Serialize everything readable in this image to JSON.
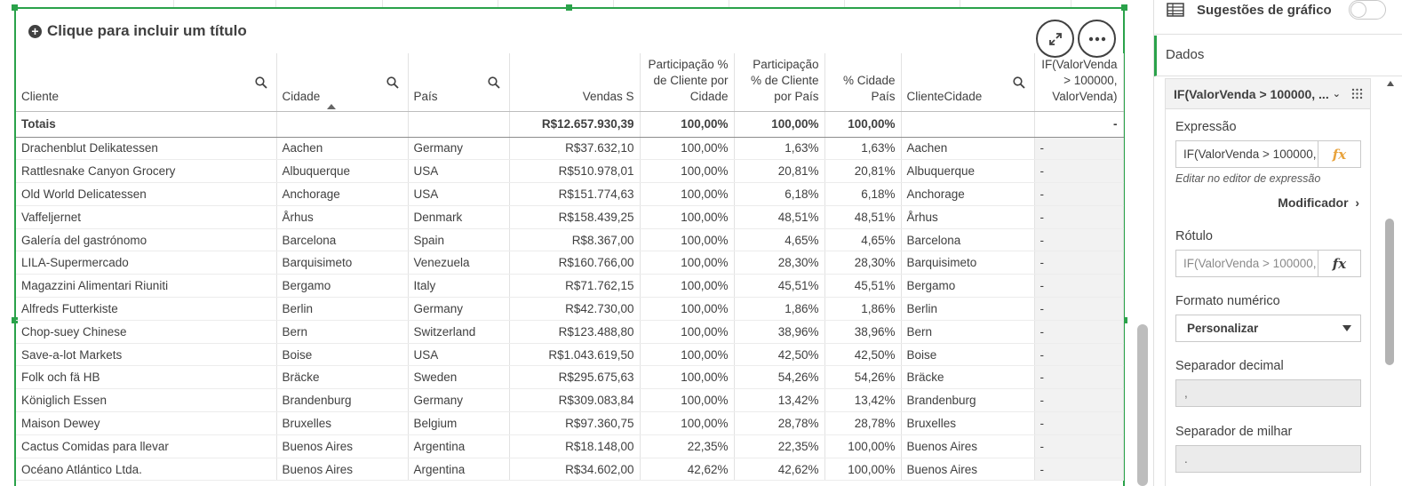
{
  "sheet": {
    "title_placeholder": "Clique para incluir um título"
  },
  "table": {
    "headers": [
      {
        "label": "Cliente",
        "searchable": true
      },
      {
        "label": "Cidade",
        "searchable": true,
        "sorted": "asc"
      },
      {
        "label": "País",
        "searchable": true
      },
      {
        "label": "Vendas S"
      },
      {
        "label": "Participação % de Cliente por Cidade"
      },
      {
        "label": "Participação % de Cliente por País"
      },
      {
        "label": "% Cidade País"
      },
      {
        "label": "ClienteCidade",
        "searchable": true
      },
      {
        "label": "IF(ValorVenda > 100000, ValorVenda)"
      }
    ],
    "totals": [
      "Totais",
      "",
      "",
      "R$12.657.930,39",
      "100,00%",
      "100,00%",
      "100,00%",
      "",
      "-"
    ],
    "rows": [
      [
        "Drachenblut Delikatessen",
        "Aachen",
        "Germany",
        "R$37.632,10",
        "100,00%",
        "1,63%",
        "1,63%",
        "Aachen",
        "-"
      ],
      [
        "Rattlesnake Canyon Grocery",
        "Albuquerque",
        "USA",
        "R$510.978,01",
        "100,00%",
        "20,81%",
        "20,81%",
        "Albuquerque",
        "-"
      ],
      [
        "Old World Delicatessen",
        "Anchorage",
        "USA",
        "R$151.774,63",
        "100,00%",
        "6,18%",
        "6,18%",
        "Anchorage",
        "-"
      ],
      [
        "Vaffeljernet",
        "Århus",
        "Denmark",
        "R$158.439,25",
        "100,00%",
        "48,51%",
        "48,51%",
        "Århus",
        "-"
      ],
      [
        "Galería del gastrónomo",
        "Barcelona",
        "Spain",
        "R$8.367,00",
        "100,00%",
        "4,65%",
        "4,65%",
        "Barcelona",
        "-"
      ],
      [
        "LILA-Supermercado",
        "Barquisimeto",
        "Venezuela",
        "R$160.766,00",
        "100,00%",
        "28,30%",
        "28,30%",
        "Barquisimeto",
        "-"
      ],
      [
        "Magazzini Alimentari Riuniti",
        "Bergamo",
        "Italy",
        "R$71.762,15",
        "100,00%",
        "45,51%",
        "45,51%",
        "Bergamo",
        "-"
      ],
      [
        "Alfreds Futterkiste",
        "Berlin",
        "Germany",
        "R$42.730,00",
        "100,00%",
        "1,86%",
        "1,86%",
        "Berlin",
        "-"
      ],
      [
        "Chop-suey Chinese",
        "Bern",
        "Switzerland",
        "R$123.488,80",
        "100,00%",
        "38,96%",
        "38,96%",
        "Bern",
        "-"
      ],
      [
        "Save-a-lot Markets",
        "Boise",
        "USA",
        "R$1.043.619,50",
        "100,00%",
        "42,50%",
        "42,50%",
        "Boise",
        "-"
      ],
      [
        "Folk och fä HB",
        "Bräcke",
        "Sweden",
        "R$295.675,63",
        "100,00%",
        "54,26%",
        "54,26%",
        "Bräcke",
        "-"
      ],
      [
        "Königlich Essen",
        "Brandenburg",
        "Germany",
        "R$309.083,84",
        "100,00%",
        "13,42%",
        "13,42%",
        "Brandenburg",
        "-"
      ],
      [
        "Maison Dewey",
        "Bruxelles",
        "Belgium",
        "R$97.360,75",
        "100,00%",
        "28,78%",
        "28,78%",
        "Bruxelles",
        "-"
      ],
      [
        "Cactus Comidas para llevar",
        "Buenos Aires",
        "Argentina",
        "R$18.148,00",
        "22,35%",
        "22,35%",
        "100,00%",
        "Buenos Aires",
        "-"
      ],
      [
        "Océano Atlántico Ltda.",
        "Buenos Aires",
        "Argentina",
        "R$34.602,00",
        "42,62%",
        "42,62%",
        "100,00%",
        "Buenos Aires",
        "-"
      ]
    ]
  },
  "panel": {
    "suggestions_label": "Sugestões de gráfico",
    "dados_label": "Dados",
    "measure_title": "IF(ValorVenda > 100000, ...",
    "expression_label": "Expressão",
    "expression_value": "IF(ValorVenda > 100000,",
    "expression_editor_hint": "Editar no editor de expressão",
    "modifier_label": "Modificador",
    "label_label": "Rótulo",
    "label_placeholder": "IF(ValorVenda > 100000,",
    "number_format_label": "Formato numérico",
    "number_format_value": "Personalizar",
    "decimal_sep_label": "Separador decimal",
    "decimal_sep_value": ",",
    "thousand_sep_label": "Separador de milhar",
    "thousand_sep_value": ".",
    "fx_symbol": "fx"
  },
  "colors": {
    "selection_green": "#2aa24a",
    "fx_orange": "#e8a33d"
  }
}
